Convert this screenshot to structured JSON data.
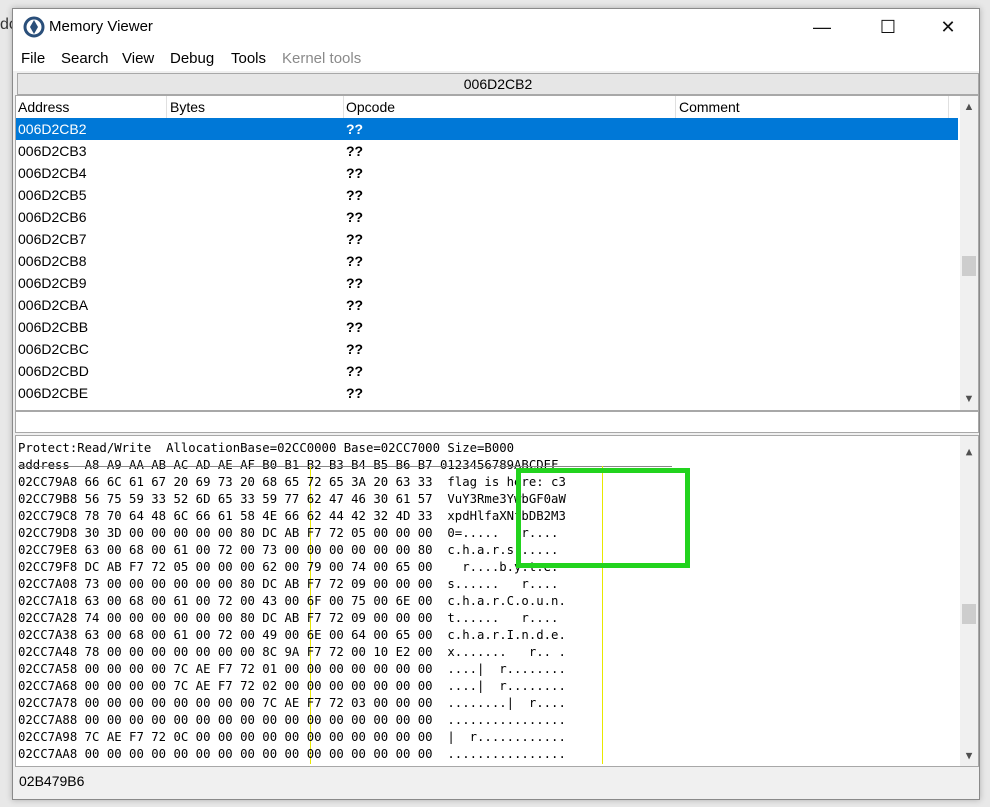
{
  "window": {
    "title": "Memory Viewer",
    "bg_fragment": "do"
  },
  "menu": [
    "File",
    "Search",
    "View",
    "Debug",
    "Tools",
    "Kernel tools"
  ],
  "menu_disabled": "Kernel tools",
  "address_bar": "006D2CB2",
  "disasm": {
    "columns": [
      "Address",
      "Bytes",
      "Opcode",
      "Comment"
    ],
    "rows": [
      {
        "address": "006D2CB2",
        "opcode": "??"
      },
      {
        "address": "006D2CB3",
        "opcode": "??"
      },
      {
        "address": "006D2CB4",
        "opcode": "??"
      },
      {
        "address": "006D2CB5",
        "opcode": "??"
      },
      {
        "address": "006D2CB6",
        "opcode": "??"
      },
      {
        "address": "006D2CB7",
        "opcode": "??"
      },
      {
        "address": "006D2CB8",
        "opcode": "??"
      },
      {
        "address": "006D2CB9",
        "opcode": "??"
      },
      {
        "address": "006D2CBA",
        "opcode": "??"
      },
      {
        "address": "006D2CBB",
        "opcode": "??"
      },
      {
        "address": "006D2CBC",
        "opcode": "??"
      },
      {
        "address": "006D2CBD",
        "opcode": "??"
      },
      {
        "address": "006D2CBE",
        "opcode": "??"
      }
    ]
  },
  "hex": {
    "info": "Protect:Read/Write  AllocationBase=02CC0000 Base=02CC7000 Size=B000",
    "header": "address  A8 A9 AA AB AC AD AE AF B0 B1 B2 B3 B4 B5 B6 B7 0123456789ABCDEF",
    "rows": [
      "02CC79A8 66 6C 61 67 20 69 73 20 68 65 72 65 3A 20 63 33  flag is here: c3",
      "02CC79B8 56 75 59 33 52 6D 65 33 59 77 62 47 46 30 61 57  VuY3Rme3YwbGF0aW",
      "02CC79C8 78 70 64 48 6C 66 61 58 4E 66 62 44 42 32 4D 33  xpdHlfaXNfbDB2M3",
      "02CC79D8 30 3D 00 00 00 00 00 80 DC AB F7 72 05 00 00 00  0=.....   r....",
      "02CC79E8 63 00 68 00 61 00 72 00 73 00 00 00 00 00 00 80  c.h.a.r.s......",
      "02CC79F8 DC AB F7 72 05 00 00 00 62 00 79 00 74 00 65 00    r....b.y.t.e.",
      "02CC7A08 73 00 00 00 00 00 00 80 DC AB F7 72 09 00 00 00  s......   r....",
      "02CC7A18 63 00 68 00 61 00 72 00 43 00 6F 00 75 00 6E 00  c.h.a.r.C.o.u.n.",
      "02CC7A28 74 00 00 00 00 00 00 80 DC AB F7 72 09 00 00 00  t......   r....",
      "02CC7A38 63 00 68 00 61 00 72 00 49 00 6E 00 64 00 65 00  c.h.a.r.I.n.d.e.",
      "02CC7A48 78 00 00 00 00 00 00 00 8C 9A F7 72 00 10 E2 00  x.......   r.. .",
      "02CC7A58 00 00 00 00 7C AE F7 72 01 00 00 00 00 00 00 00  ....|  r........",
      "02CC7A68 00 00 00 00 7C AE F7 72 02 00 00 00 00 00 00 00  ....|  r........",
      "02CC7A78 00 00 00 00 00 00 00 00 7C AE F7 72 03 00 00 00  ........|  r....",
      "02CC7A88 00 00 00 00 00 00 00 00 00 00 00 00 00 00 00 00  ................",
      "02CC7A98 7C AE F7 72 0C 00 00 00 00 00 00 00 00 00 00 00  |  r............",
      "02CC7AA8 00 00 00 00 00 00 00 00 00 00 00 00 00 00 00 00  ................"
    ]
  },
  "status": "02B479B6",
  "colors": {
    "selection": "#0078d7",
    "highlight_box": "#22d31e",
    "guide": "#e8e800"
  }
}
